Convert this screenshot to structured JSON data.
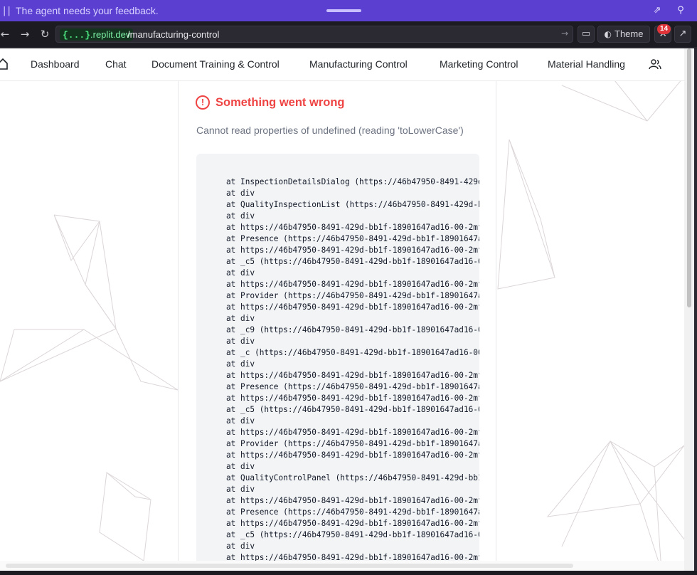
{
  "feedback_bar": {
    "message": "The agent needs your feedback."
  },
  "browser": {
    "domain_braces": "{...}",
    "domain": ".replit.dev",
    "path": "/manufacturing-control",
    "theme_label": "Theme",
    "notification_count": "14"
  },
  "nav": {
    "items": [
      {
        "label": "Dashboard"
      },
      {
        "label": "Chat"
      },
      {
        "label": "Document Training & Control"
      },
      {
        "label": "Manufacturing Control"
      },
      {
        "label": "Marketing Control"
      },
      {
        "label": "Material Handling"
      }
    ]
  },
  "error": {
    "title": "Something went wrong",
    "icon": "!",
    "message": "Cannot read properties of undefined (reading 'toLowerCase')",
    "stack": [
      "at InspectionDetailsDialog (https://46b47950-8491-429d",
      "at div",
      "at QualityInspectionList (https://46b47950-8491-429d-b",
      "at div",
      "at https://46b47950-8491-429d-bb1f-18901647ad16-00-2mf",
      "at Presence (https://46b47950-8491-429d-bb1f-18901647a",
      "at https://46b47950-8491-429d-bb1f-18901647ad16-00-2mf",
      "at _c5 (https://46b47950-8491-429d-bb1f-18901647ad16-0",
      "at div",
      "at https://46b47950-8491-429d-bb1f-18901647ad16-00-2mf",
      "at Provider (https://46b47950-8491-429d-bb1f-18901647a",
      "at https://46b47950-8491-429d-bb1f-18901647ad16-00-2mf",
      "at div",
      "at _c9 (https://46b47950-8491-429d-bb1f-18901647ad16-0",
      "at div",
      "at _c (https://46b47950-8491-429d-bb1f-18901647ad16-00",
      "at div",
      "at https://46b47950-8491-429d-bb1f-18901647ad16-00-2mf",
      "at Presence (https://46b47950-8491-429d-bb1f-18901647a",
      "at https://46b47950-8491-429d-bb1f-18901647ad16-00-2mf",
      "at _c5 (https://46b47950-8491-429d-bb1f-18901647ad16-0",
      "at div",
      "at https://46b47950-8491-429d-bb1f-18901647ad16-00-2mf",
      "at Provider (https://46b47950-8491-429d-bb1f-18901647a",
      "at https://46b47950-8491-429d-bb1f-18901647ad16-00-2mf",
      "at div",
      "at QualityControlPanel (https://46b47950-8491-429d-bb1",
      "at div",
      "at https://46b47950-8491-429d-bb1f-18901647ad16-00-2mf",
      "at Presence (https://46b47950-8491-429d-bb1f-18901647a",
      "at https://46b47950-8491-429d-bb1f-18901647ad16-00-2mf",
      "at _c5 (https://46b47950-8491-429d-bb1f-18901647ad16-0",
      "at div",
      "at https://46b47950-8491-429d-bb1f-18901647ad16-00-2mf"
    ]
  },
  "icons": {
    "pause": "pause-icon",
    "popout": "popout-icon",
    "pin": "pin-icon",
    "back": "back-arrow-icon",
    "forward": "forward-arrow-icon",
    "reload": "reload-icon",
    "go": "go-arrow-icon",
    "devices": "device-icon",
    "palette": "palette-icon",
    "tools": "wrench-icon",
    "external": "external-link-icon",
    "home": "home-icon",
    "users": "users-icon",
    "error": "alert-circle-icon"
  },
  "colors": {
    "feedback_bar": "#5b3fd1",
    "error": "#ef4444",
    "domain_green": "#4ce680"
  }
}
